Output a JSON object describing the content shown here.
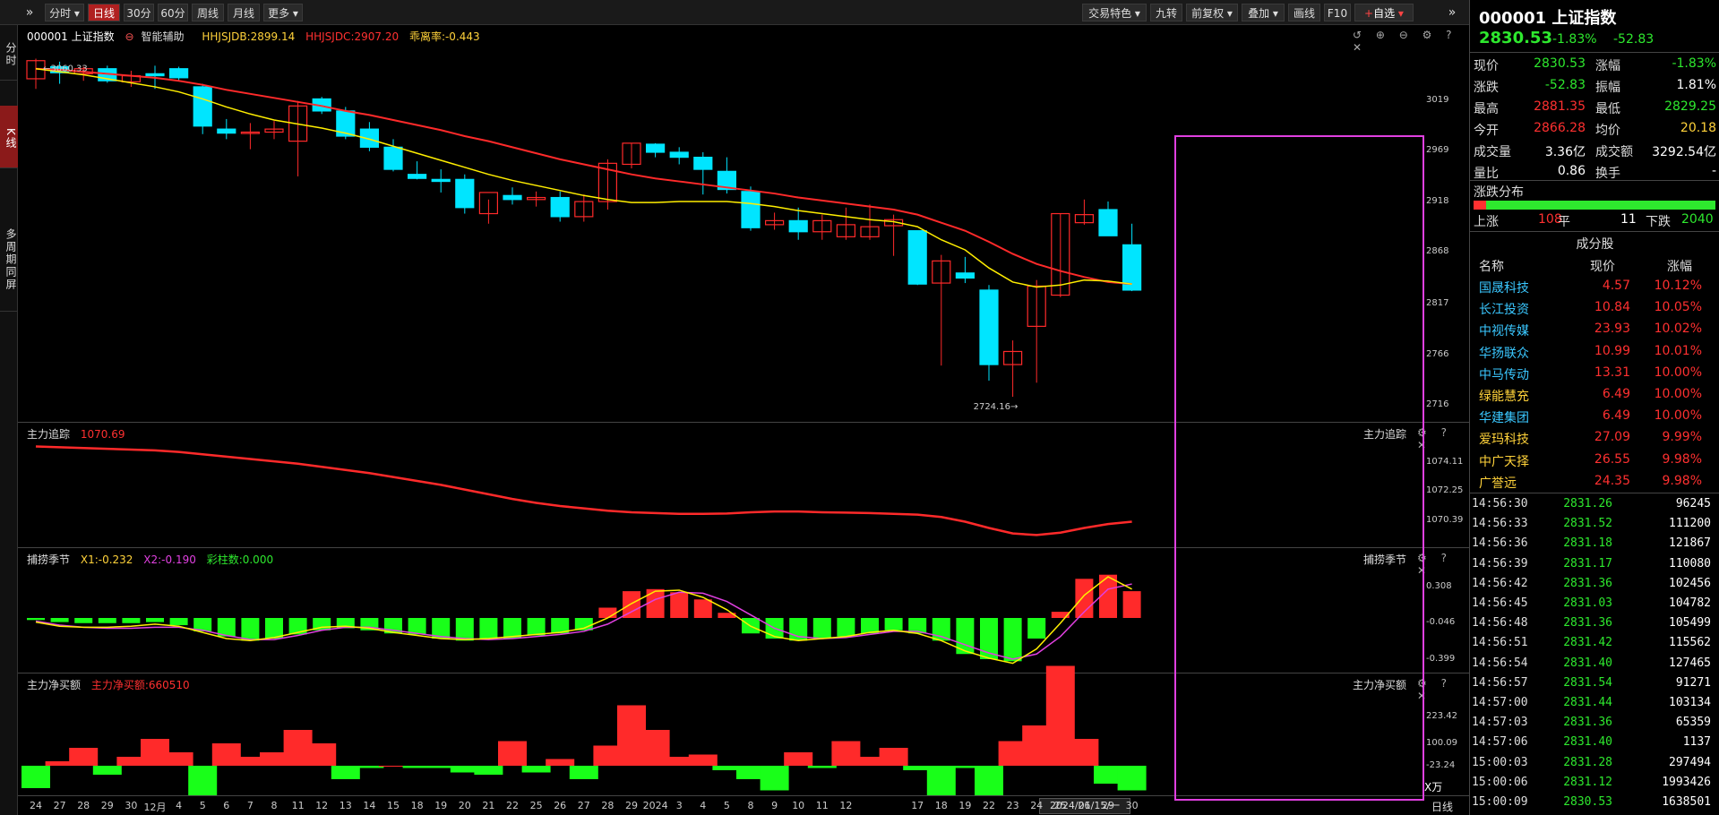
{
  "left_tabs": [
    "分时",
    "K线",
    "多周期同屏"
  ],
  "toolbar": {
    "left": [
      "分时",
      "日线",
      "30分",
      "60分",
      "周线",
      "月线",
      "更多"
    ],
    "right": [
      "交易特色",
      "九转",
      "前复权",
      "叠加",
      "画线",
      "F10",
      "自选"
    ]
  },
  "main": {
    "code": "000001 上证指数",
    "assist": "智能辅助",
    "ind1": "HHJSJDB:2899.14",
    "ind2": "HHJSJDC:2907.20",
    "ind3": "乖离率:-0.443",
    "high_label": "3060.33",
    "low_label": "2724.16",
    "yticks": [
      "3019",
      "2969",
      "2918",
      "2868",
      "2817",
      "2766",
      "2716"
    ]
  },
  "p2": {
    "title": "主力追踪",
    "value": "1070.69",
    "right_title": "主力追踪",
    "yticks": [
      "1074.11",
      "1072.25",
      "1070.39"
    ]
  },
  "p3": {
    "title": "捕捞季节",
    "x1": "X1:-0.232",
    "x2": "X2:-0.190",
    "cz": "彩柱数:0.000",
    "right_title": "捕捞季节",
    "yticks": [
      "0.308",
      "-0.046",
      "-0.399"
    ]
  },
  "p4": {
    "title": "主力净买额",
    "value": "主力净买额:660510",
    "right_title": "主力净买额",
    "yticks": [
      "223.42",
      "100.09",
      "-23.24"
    ],
    "unit": "X万"
  },
  "xaxis": {
    "labels": [
      "24",
      "27",
      "28",
      "29",
      "30",
      "12月",
      "4",
      "5",
      "6",
      "7",
      "8",
      "11",
      "12",
      "13",
      "14",
      "15",
      "18",
      "19",
      "20",
      "21",
      "22",
      "25",
      "26",
      "27",
      "28",
      "29",
      "2024",
      "3",
      "4",
      "5",
      "8",
      "9",
      "10",
      "11",
      "12",
      "",
      "",
      "17",
      "18",
      "19",
      "22",
      "23",
      "24",
      "25",
      "26",
      "29",
      "30"
    ],
    "selected": "2024/01/15/一",
    "period": "日线"
  },
  "quote": {
    "code": "000001 上证指数",
    "price": "2830.53",
    "pct": "-1.83%",
    "chg": "-52.83",
    "rows": [
      [
        "现价",
        "2830.53",
        "涨幅",
        "-1.83%"
      ],
      [
        "涨跌",
        "-52.83",
        "振幅",
        "1.81%"
      ],
      [
        "最高",
        "2881.35",
        "最低",
        "2829.25"
      ],
      [
        "今开",
        "2866.28",
        "均价",
        "20.18"
      ],
      [
        "成交量",
        "3.36亿",
        "成交额",
        "3292.54亿"
      ],
      [
        "量比",
        "0.86",
        "换手",
        "-"
      ]
    ],
    "dist_title": "涨跌分布",
    "up_label": "上涨",
    "up": "108",
    "flat_label": "平",
    "flat": "11",
    "down_label": "下跌",
    "down": "2040",
    "comp_title": "成分股",
    "comp_headers": [
      "名称",
      "现价",
      "涨幅"
    ],
    "components": [
      [
        "国晟科技",
        "4.57",
        "10.12%",
        "cyan"
      ],
      [
        "长江投资",
        "10.84",
        "10.05%",
        "cyan"
      ],
      [
        "中视传媒",
        "23.93",
        "10.02%",
        "cyan"
      ],
      [
        "华扬联众",
        "10.99",
        "10.01%",
        "cyan"
      ],
      [
        "中马传动",
        "13.31",
        "10.00%",
        "cyan"
      ],
      [
        "绿能慧充",
        "6.49",
        "10.00%",
        "yellow"
      ],
      [
        "华建集团",
        "6.49",
        "10.00%",
        "cyan"
      ],
      [
        "爱玛科技",
        "27.09",
        "9.99%",
        "yellow"
      ],
      [
        "中广天择",
        "26.55",
        "9.98%",
        "yellow"
      ],
      [
        "广誉远",
        "24.35",
        "9.98%",
        "yellow"
      ]
    ],
    "ticks": [
      [
        "14:56:30",
        "2831.26",
        "96245"
      ],
      [
        "14:56:33",
        "2831.52",
        "111200"
      ],
      [
        "14:56:36",
        "2831.18",
        "121867"
      ],
      [
        "14:56:39",
        "2831.17",
        "110080"
      ],
      [
        "14:56:42",
        "2831.36",
        "102456"
      ],
      [
        "14:56:45",
        "2831.03",
        "104782"
      ],
      [
        "14:56:48",
        "2831.36",
        "105499"
      ],
      [
        "14:56:51",
        "2831.42",
        "115562"
      ],
      [
        "14:56:54",
        "2831.40",
        "127465"
      ],
      [
        "14:56:57",
        "2831.54",
        "91271"
      ],
      [
        "14:57:00",
        "2831.44",
        "103134"
      ],
      [
        "14:57:03",
        "2831.36",
        "65359"
      ],
      [
        "14:57:06",
        "2831.40",
        "1137"
      ],
      [
        "15:00:03",
        "2831.28",
        "297494"
      ],
      [
        "15:00:06",
        "2831.12",
        "1993426"
      ],
      [
        "15:00:09",
        "2830.53",
        "1638501"
      ]
    ]
  },
  "chart_data": {
    "type": "candlestick",
    "dates": [
      "11-24",
      "11-27",
      "11-28",
      "11-29",
      "11-30",
      "12-01",
      "12-04",
      "12-05",
      "12-06",
      "12-07",
      "12-08",
      "12-11",
      "12-12",
      "12-13",
      "12-14",
      "12-15",
      "12-18",
      "12-19",
      "12-20",
      "12-21",
      "12-22",
      "12-25",
      "12-26",
      "12-27",
      "12-28",
      "12-29",
      "01-02",
      "01-03",
      "01-04",
      "01-05",
      "01-08",
      "01-09",
      "01-10",
      "01-11",
      "01-12",
      "01-15",
      "01-16",
      "01-17",
      "01-18",
      "01-19",
      "01-22",
      "01-23",
      "01-24",
      "01-25",
      "01-26",
      "01-29",
      "01-30"
    ],
    "ohlc": [
      [
        3040,
        3060,
        3030,
        3058
      ],
      [
        3052,
        3057,
        3035,
        3046
      ],
      [
        3045,
        3052,
        3038,
        3050
      ],
      [
        3050,
        3053,
        3036,
        3038
      ],
      [
        3037,
        3048,
        3032,
        3043
      ],
      [
        3045,
        3053,
        3030,
        3043
      ],
      [
        3050,
        3052,
        3038,
        3041
      ],
      [
        3032,
        3035,
        2985,
        2993
      ],
      [
        2990,
        3000,
        2980,
        2986
      ],
      [
        2986,
        2996,
        2970,
        2987
      ],
      [
        2987,
        2998,
        2980,
        2990
      ],
      [
        2978,
        3018,
        2943,
        3013
      ],
      [
        3020,
        3022,
        3005,
        3008
      ],
      [
        3008,
        3012,
        2980,
        2983
      ],
      [
        2990,
        2997,
        2968,
        2972
      ],
      [
        2972,
        2980,
        2948,
        2950
      ],
      [
        2945,
        2958,
        2940,
        2941
      ],
      [
        2940,
        2950,
        2927,
        2938
      ],
      [
        2940,
        2945,
        2906,
        2912
      ],
      [
        2906,
        2920,
        2896,
        2927
      ],
      [
        2924,
        2932,
        2915,
        2920
      ],
      [
        2920,
        2928,
        2913,
        2922
      ],
      [
        2922,
        2928,
        2898,
        2903
      ],
      [
        2903,
        2925,
        2898,
        2918
      ],
      [
        2918,
        2960,
        2910,
        2956
      ],
      [
        2955,
        2976,
        2951,
        2976
      ],
      [
        2975,
        2976,
        2962,
        2967
      ],
      [
        2967,
        2972,
        2955,
        2962
      ],
      [
        2962,
        2967,
        2925,
        2950
      ],
      [
        2948,
        2962,
        2926,
        2930
      ],
      [
        2928,
        2933,
        2889,
        2892
      ],
      [
        2895,
        2907,
        2890,
        2899
      ],
      [
        2899,
        2912,
        2880,
        2888
      ],
      [
        2888,
        2905,
        2880,
        2899
      ],
      [
        2883,
        2912,
        2880,
        2895
      ],
      [
        2883,
        2915,
        2880,
        2893
      ],
      [
        2894,
        2905,
        2864,
        2900
      ],
      [
        2889,
        2889,
        2835,
        2836
      ],
      [
        2837,
        2865,
        2755,
        2859
      ],
      [
        2847,
        2863,
        2837,
        2842
      ],
      [
        2830,
        2835,
        2740,
        2756
      ],
      [
        2756,
        2780,
        2724,
        2769
      ],
      [
        2794,
        2840,
        2738,
        2834
      ],
      [
        2825,
        2906,
        2823,
        2906
      ],
      [
        2897,
        2920,
        2895,
        2905
      ],
      [
        2910,
        2918,
        2884,
        2884
      ],
      [
        2875,
        2896,
        2829,
        2830
      ]
    ],
    "ma_yellow": [
      3050,
      3047,
      3044,
      3040,
      3036,
      3032,
      3027,
      3020,
      3012,
      3005,
      2999,
      2995,
      2991,
      2986,
      2980,
      2973,
      2966,
      2959,
      2952,
      2945,
      2939,
      2934,
      2929,
      2924,
      2920,
      2917,
      2917,
      2918,
      2918,
      2918,
      2916,
      2913,
      2909,
      2906,
      2903,
      2900,
      2898,
      2893,
      2880,
      2870,
      2852,
      2838,
      2833,
      2835,
      2840,
      2839,
      2836
    ],
    "ma_red": [
      3050,
      3049,
      3047,
      3045,
      3043,
      3041,
      3038,
      3034,
      3029,
      3025,
      3021,
      3017,
      3013,
      3008,
      3004,
      2999,
      2994,
      2989,
      2983,
      2978,
      2972,
      2966,
      2960,
      2955,
      2950,
      2945,
      2941,
      2938,
      2935,
      2932,
      2929,
      2926,
      2922,
      2919,
      2916,
      2913,
      2910,
      2905,
      2897,
      2889,
      2878,
      2866,
      2856,
      2849,
      2843,
      2838,
      2836
    ],
    "zl_track": [
      1075.1,
      1075.05,
      1075.0,
      1074.95,
      1074.9,
      1074.85,
      1074.75,
      1074.6,
      1074.45,
      1074.3,
      1074.15,
      1074.0,
      1073.8,
      1073.6,
      1073.4,
      1073.15,
      1072.9,
      1072.65,
      1072.35,
      1072.05,
      1071.75,
      1071.5,
      1071.3,
      1071.15,
      1071.0,
      1070.9,
      1070.85,
      1070.8,
      1070.8,
      1070.82,
      1070.9,
      1070.95,
      1070.95,
      1070.9,
      1070.88,
      1070.85,
      1070.8,
      1070.75,
      1070.6,
      1070.3,
      1069.9,
      1069.55,
      1069.45,
      1069.6,
      1069.9,
      1070.15,
      1070.3
    ],
    "bulao_bars": [
      -0.02,
      -0.04,
      -0.05,
      -0.05,
      -0.05,
      -0.04,
      -0.07,
      -0.13,
      -0.18,
      -0.22,
      -0.2,
      -0.16,
      -0.12,
      -0.1,
      -0.12,
      -0.15,
      -0.16,
      -0.2,
      -0.22,
      -0.21,
      -0.2,
      -0.17,
      -0.15,
      -0.12,
      0.1,
      0.26,
      0.28,
      0.25,
      0.18,
      0.05,
      -0.15,
      -0.2,
      -0.22,
      -0.2,
      -0.18,
      -0.15,
      -0.12,
      -0.15,
      -0.22,
      -0.35,
      -0.4,
      -0.42,
      -0.2,
      0.06,
      0.38,
      0.42,
      0.26
    ],
    "bulao_x1": [
      -0.04,
      -0.08,
      -0.09,
      -0.09,
      -0.08,
      -0.06,
      -0.08,
      -0.14,
      -0.2,
      -0.22,
      -0.19,
      -0.14,
      -0.09,
      -0.08,
      -0.1,
      -0.14,
      -0.17,
      -0.2,
      -0.21,
      -0.2,
      -0.18,
      -0.16,
      -0.14,
      -0.1,
      0.0,
      0.14,
      0.26,
      0.27,
      0.2,
      0.08,
      -0.08,
      -0.18,
      -0.22,
      -0.2,
      -0.18,
      -0.14,
      -0.12,
      -0.15,
      -0.22,
      -0.32,
      -0.39,
      -0.44,
      -0.3,
      -0.05,
      0.22,
      0.4,
      0.28
    ],
    "bulao_x2": [
      -0.03,
      -0.07,
      -0.09,
      -0.1,
      -0.1,
      -0.09,
      -0.09,
      -0.12,
      -0.17,
      -0.21,
      -0.21,
      -0.17,
      -0.12,
      -0.09,
      -0.09,
      -0.12,
      -0.15,
      -0.18,
      -0.2,
      -0.21,
      -0.2,
      -0.18,
      -0.16,
      -0.13,
      -0.06,
      0.06,
      0.18,
      0.25,
      0.24,
      0.16,
      0.03,
      -0.1,
      -0.18,
      -0.2,
      -0.19,
      -0.16,
      -0.13,
      -0.13,
      -0.18,
      -0.26,
      -0.34,
      -0.4,
      -0.35,
      -0.18,
      0.06,
      0.28,
      0.33
    ],
    "net_buy": [
      -50,
      10,
      40,
      -20,
      20,
      60,
      30,
      -110,
      50,
      20,
      30,
      80,
      50,
      -30,
      -5,
      0,
      -5,
      -5,
      -15,
      -20,
      55,
      -15,
      15,
      -30,
      45,
      135,
      80,
      20,
      25,
      -10,
      -30,
      -55,
      30,
      -5,
      55,
      20,
      40,
      -10,
      -100,
      -5,
      -90,
      55,
      90,
      223,
      60,
      -40,
      -55
    ]
  }
}
